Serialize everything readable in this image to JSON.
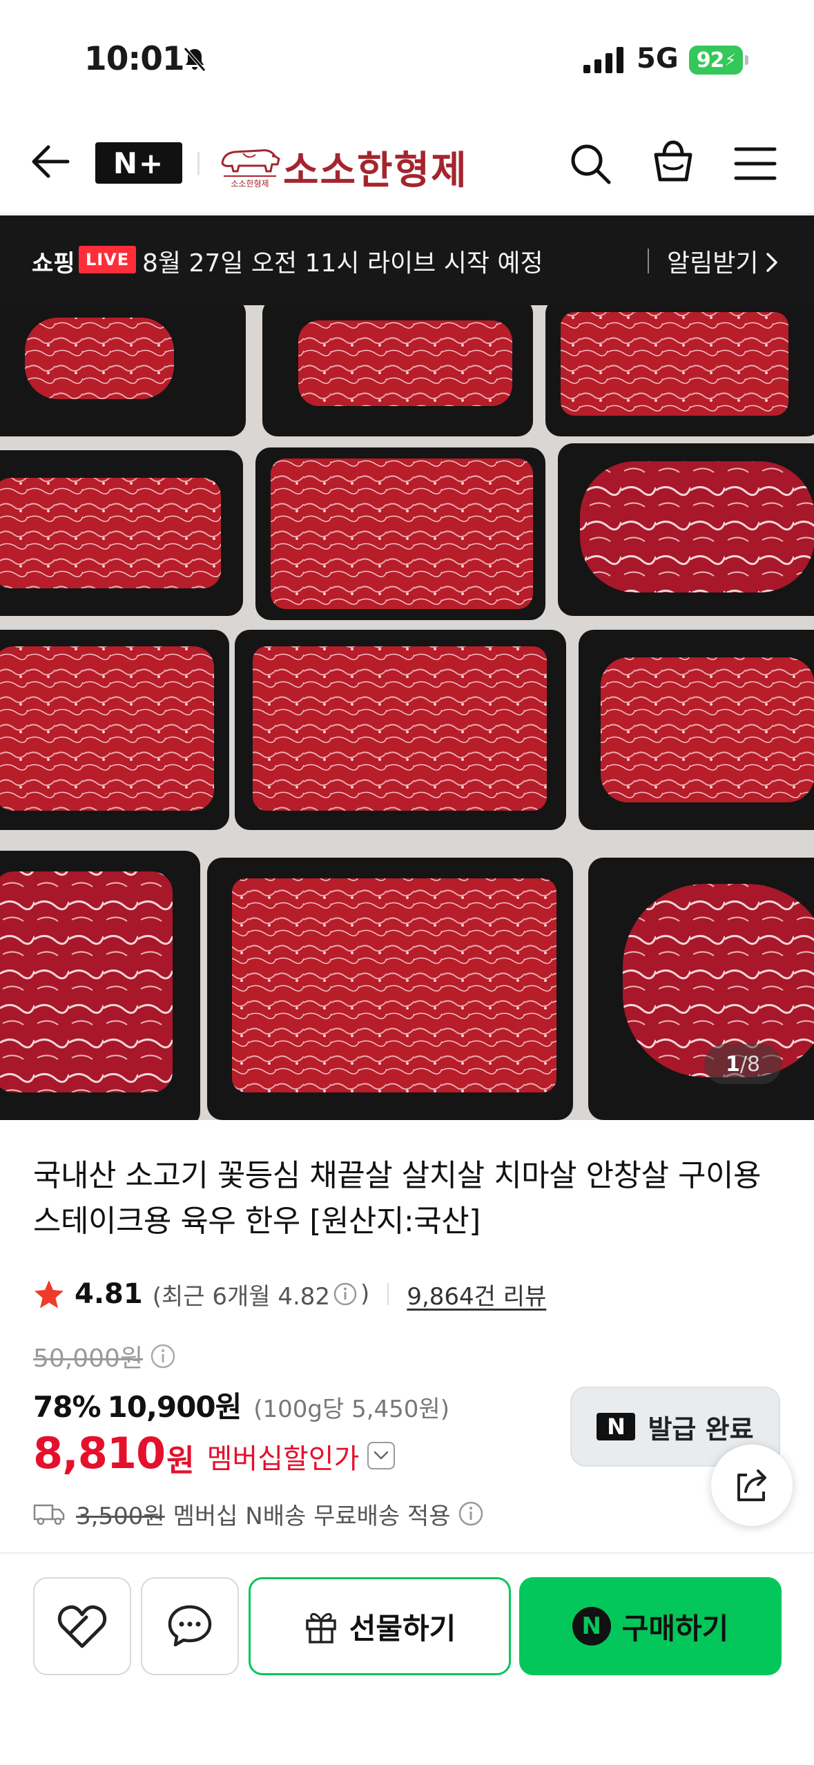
{
  "status_bar": {
    "time": "10:01",
    "network": "5G",
    "battery": "92"
  },
  "header": {
    "badge_label": "N+",
    "brand_name": "소소한형제",
    "logo_text": "소소한형제"
  },
  "live_banner": {
    "shop_label": "쇼핑",
    "live_badge": "LIVE",
    "message": "8월 27일 오전 11시 라이브 시작 예정",
    "notify_label": "알림받기"
  },
  "gallery": {
    "current": "1",
    "total": "/8"
  },
  "product": {
    "title": "국내산 소고기 꽃등심 채끝살 살치살 치마살 안창살 구이용 스테이크용 육우 한우 [원산지:국산]",
    "rating": "4.81",
    "recent_rating_prefix": "(최근 6개월 4.82",
    "recent_rating_suffix": ")",
    "reviews": "9,864건 리뷰",
    "original_price": "50,000원",
    "discount_percent": "78%",
    "sale_price": "10,900원",
    "unit_price": "(100g당 5,450원)",
    "member_price": "8,810",
    "member_price_unit": "원",
    "member_price_label": "멤버십할인가",
    "coupon_mark": "N",
    "coupon_label": "발급 완료",
    "shipping_fee": "3,500원",
    "shipping_note": "멤버십 N배송 무료배송 적용"
  },
  "actions": {
    "gift_label": "선물하기",
    "buy_mark": "N",
    "buy_label": "구매하기"
  },
  "colors": {
    "brand_green": "#03c75a",
    "member_red": "#e5102c",
    "brand_maroon": "#a4252e",
    "live_red": "#ff2d3a",
    "star": "#ee3b2b"
  }
}
